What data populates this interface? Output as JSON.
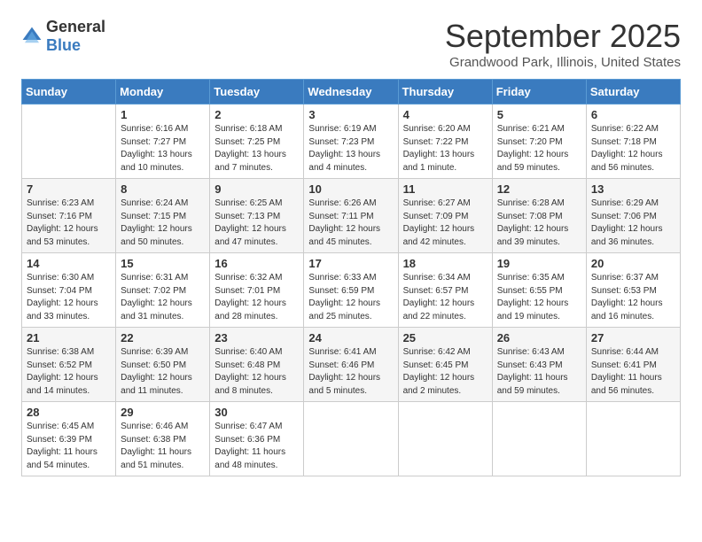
{
  "header": {
    "logo_general": "General",
    "logo_blue": "Blue",
    "month": "September 2025",
    "location": "Grandwood Park, Illinois, United States"
  },
  "days_of_week": [
    "Sunday",
    "Monday",
    "Tuesday",
    "Wednesday",
    "Thursday",
    "Friday",
    "Saturday"
  ],
  "weeks": [
    [
      {
        "day": "",
        "sunrise": "",
        "sunset": "",
        "daylight": ""
      },
      {
        "day": "1",
        "sunrise": "Sunrise: 6:16 AM",
        "sunset": "Sunset: 7:27 PM",
        "daylight": "Daylight: 13 hours and 10 minutes."
      },
      {
        "day": "2",
        "sunrise": "Sunrise: 6:18 AM",
        "sunset": "Sunset: 7:25 PM",
        "daylight": "Daylight: 13 hours and 7 minutes."
      },
      {
        "day": "3",
        "sunrise": "Sunrise: 6:19 AM",
        "sunset": "Sunset: 7:23 PM",
        "daylight": "Daylight: 13 hours and 4 minutes."
      },
      {
        "day": "4",
        "sunrise": "Sunrise: 6:20 AM",
        "sunset": "Sunset: 7:22 PM",
        "daylight": "Daylight: 13 hours and 1 minute."
      },
      {
        "day": "5",
        "sunrise": "Sunrise: 6:21 AM",
        "sunset": "Sunset: 7:20 PM",
        "daylight": "Daylight: 12 hours and 59 minutes."
      },
      {
        "day": "6",
        "sunrise": "Sunrise: 6:22 AM",
        "sunset": "Sunset: 7:18 PM",
        "daylight": "Daylight: 12 hours and 56 minutes."
      }
    ],
    [
      {
        "day": "7",
        "sunrise": "Sunrise: 6:23 AM",
        "sunset": "Sunset: 7:16 PM",
        "daylight": "Daylight: 12 hours and 53 minutes."
      },
      {
        "day": "8",
        "sunrise": "Sunrise: 6:24 AM",
        "sunset": "Sunset: 7:15 PM",
        "daylight": "Daylight: 12 hours and 50 minutes."
      },
      {
        "day": "9",
        "sunrise": "Sunrise: 6:25 AM",
        "sunset": "Sunset: 7:13 PM",
        "daylight": "Daylight: 12 hours and 47 minutes."
      },
      {
        "day": "10",
        "sunrise": "Sunrise: 6:26 AM",
        "sunset": "Sunset: 7:11 PM",
        "daylight": "Daylight: 12 hours and 45 minutes."
      },
      {
        "day": "11",
        "sunrise": "Sunrise: 6:27 AM",
        "sunset": "Sunset: 7:09 PM",
        "daylight": "Daylight: 12 hours and 42 minutes."
      },
      {
        "day": "12",
        "sunrise": "Sunrise: 6:28 AM",
        "sunset": "Sunset: 7:08 PM",
        "daylight": "Daylight: 12 hours and 39 minutes."
      },
      {
        "day": "13",
        "sunrise": "Sunrise: 6:29 AM",
        "sunset": "Sunset: 7:06 PM",
        "daylight": "Daylight: 12 hours and 36 minutes."
      }
    ],
    [
      {
        "day": "14",
        "sunrise": "Sunrise: 6:30 AM",
        "sunset": "Sunset: 7:04 PM",
        "daylight": "Daylight: 12 hours and 33 minutes."
      },
      {
        "day": "15",
        "sunrise": "Sunrise: 6:31 AM",
        "sunset": "Sunset: 7:02 PM",
        "daylight": "Daylight: 12 hours and 31 minutes."
      },
      {
        "day": "16",
        "sunrise": "Sunrise: 6:32 AM",
        "sunset": "Sunset: 7:01 PM",
        "daylight": "Daylight: 12 hours and 28 minutes."
      },
      {
        "day": "17",
        "sunrise": "Sunrise: 6:33 AM",
        "sunset": "Sunset: 6:59 PM",
        "daylight": "Daylight: 12 hours and 25 minutes."
      },
      {
        "day": "18",
        "sunrise": "Sunrise: 6:34 AM",
        "sunset": "Sunset: 6:57 PM",
        "daylight": "Daylight: 12 hours and 22 minutes."
      },
      {
        "day": "19",
        "sunrise": "Sunrise: 6:35 AM",
        "sunset": "Sunset: 6:55 PM",
        "daylight": "Daylight: 12 hours and 19 minutes."
      },
      {
        "day": "20",
        "sunrise": "Sunrise: 6:37 AM",
        "sunset": "Sunset: 6:53 PM",
        "daylight": "Daylight: 12 hours and 16 minutes."
      }
    ],
    [
      {
        "day": "21",
        "sunrise": "Sunrise: 6:38 AM",
        "sunset": "Sunset: 6:52 PM",
        "daylight": "Daylight: 12 hours and 14 minutes."
      },
      {
        "day": "22",
        "sunrise": "Sunrise: 6:39 AM",
        "sunset": "Sunset: 6:50 PM",
        "daylight": "Daylight: 12 hours and 11 minutes."
      },
      {
        "day": "23",
        "sunrise": "Sunrise: 6:40 AM",
        "sunset": "Sunset: 6:48 PM",
        "daylight": "Daylight: 12 hours and 8 minutes."
      },
      {
        "day": "24",
        "sunrise": "Sunrise: 6:41 AM",
        "sunset": "Sunset: 6:46 PM",
        "daylight": "Daylight: 12 hours and 5 minutes."
      },
      {
        "day": "25",
        "sunrise": "Sunrise: 6:42 AM",
        "sunset": "Sunset: 6:45 PM",
        "daylight": "Daylight: 12 hours and 2 minutes."
      },
      {
        "day": "26",
        "sunrise": "Sunrise: 6:43 AM",
        "sunset": "Sunset: 6:43 PM",
        "daylight": "Daylight: 11 hours and 59 minutes."
      },
      {
        "day": "27",
        "sunrise": "Sunrise: 6:44 AM",
        "sunset": "Sunset: 6:41 PM",
        "daylight": "Daylight: 11 hours and 56 minutes."
      }
    ],
    [
      {
        "day": "28",
        "sunrise": "Sunrise: 6:45 AM",
        "sunset": "Sunset: 6:39 PM",
        "daylight": "Daylight: 11 hours and 54 minutes."
      },
      {
        "day": "29",
        "sunrise": "Sunrise: 6:46 AM",
        "sunset": "Sunset: 6:38 PM",
        "daylight": "Daylight: 11 hours and 51 minutes."
      },
      {
        "day": "30",
        "sunrise": "Sunrise: 6:47 AM",
        "sunset": "Sunset: 6:36 PM",
        "daylight": "Daylight: 11 hours and 48 minutes."
      },
      {
        "day": "",
        "sunrise": "",
        "sunset": "",
        "daylight": ""
      },
      {
        "day": "",
        "sunrise": "",
        "sunset": "",
        "daylight": ""
      },
      {
        "day": "",
        "sunrise": "",
        "sunset": "",
        "daylight": ""
      },
      {
        "day": "",
        "sunrise": "",
        "sunset": "",
        "daylight": ""
      }
    ]
  ]
}
